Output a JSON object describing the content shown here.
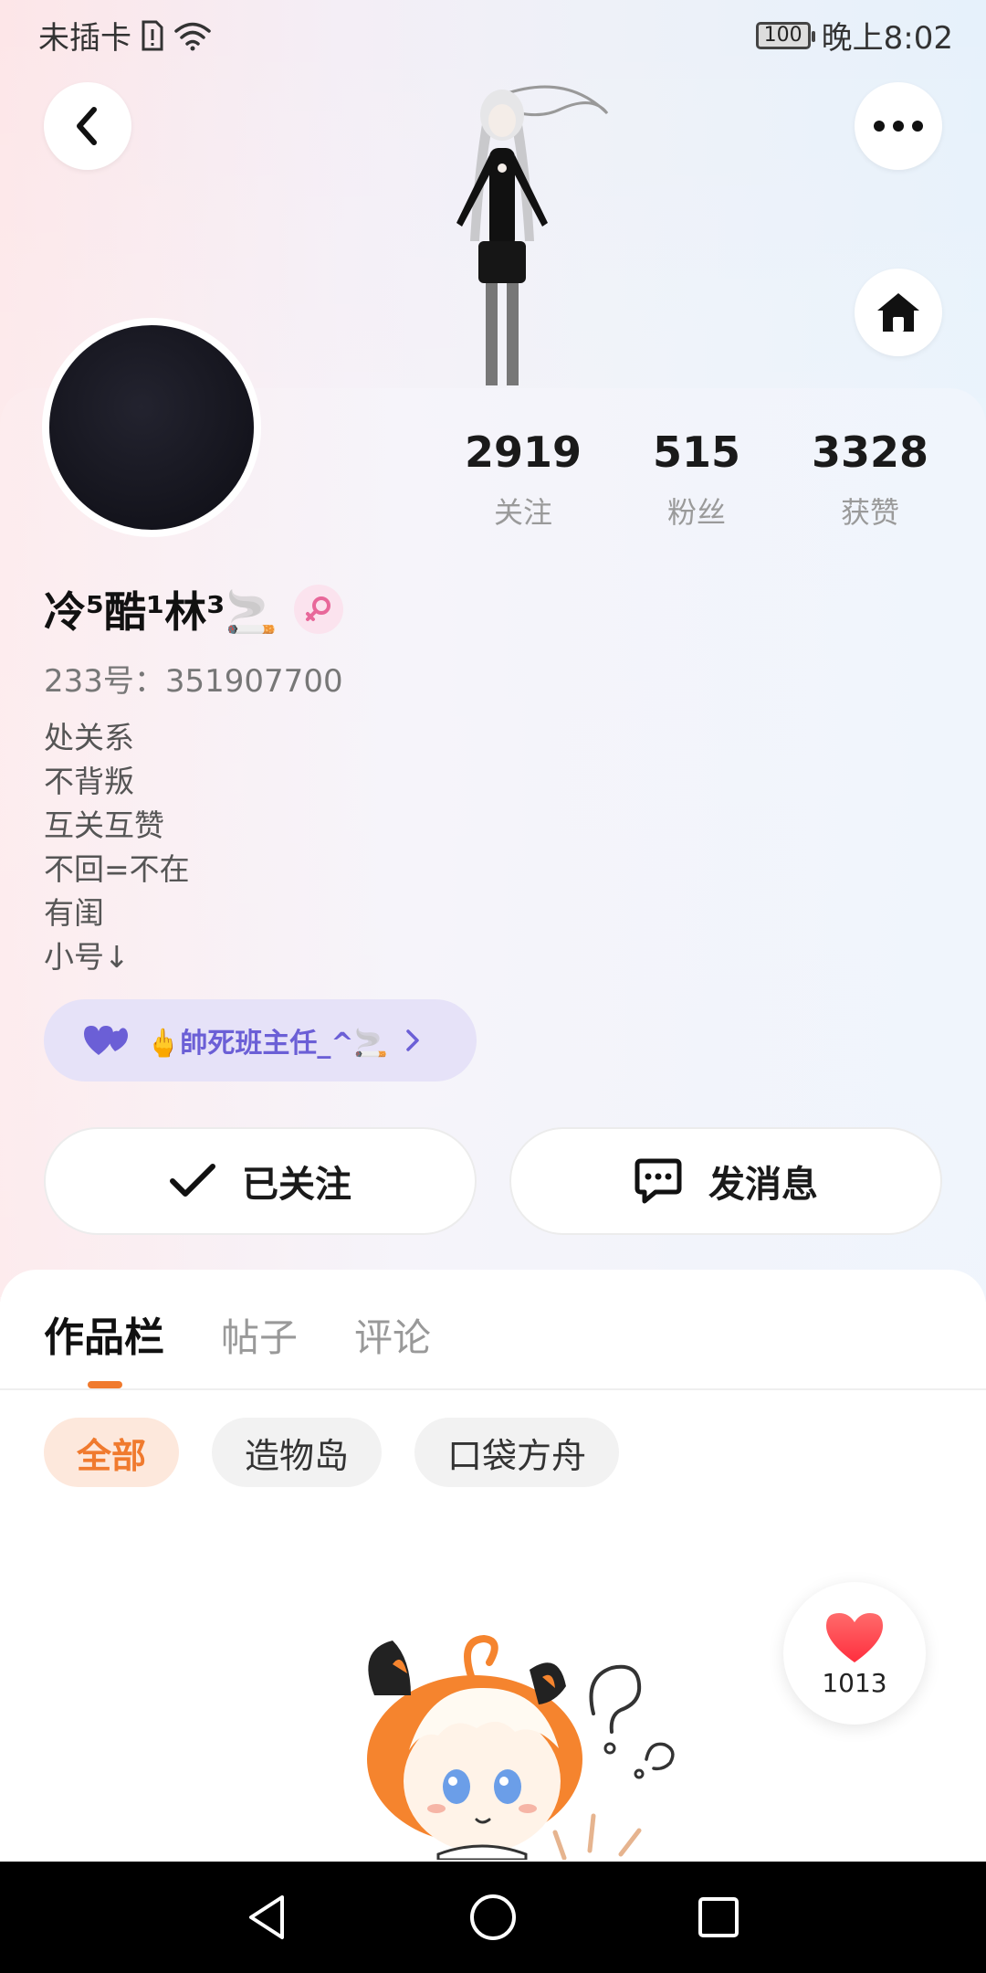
{
  "status_bar": {
    "carrier": "未插卡",
    "battery": "100",
    "time": "晚上8:02"
  },
  "header": {
    "back_icon": "chevron-left-icon",
    "more_icon": "more-dots-icon",
    "home_icon": "home-icon"
  },
  "profile": {
    "stats": [
      {
        "value": "2919",
        "label": "关注"
      },
      {
        "value": "515",
        "label": "粉丝"
      },
      {
        "value": "3328",
        "label": "获赞"
      }
    ],
    "username": "冷⁵酷¹林³🚬",
    "uid": "233号：351907700",
    "bio": [
      "处关系",
      "不背叛",
      "互关互赞",
      "不回=不在",
      "有闺",
      "小号↓"
    ],
    "linked_account": "🖕帥死班主任_^🚬",
    "follow_button": "已关注",
    "message_button": "发消息"
  },
  "tabs": [
    {
      "label": "作品栏",
      "active": true
    },
    {
      "label": "帖子",
      "active": false
    },
    {
      "label": "评论",
      "active": false
    }
  ],
  "filters": [
    {
      "label": "全部",
      "active": true
    },
    {
      "label": "造物岛",
      "active": false
    },
    {
      "label": "口袋方舟",
      "active": false
    }
  ],
  "like_fab": {
    "count": "1013"
  },
  "colors": {
    "accent": "#f07a2e",
    "guild_text": "#6b5fd6",
    "guild_bg": "#e6e2f8"
  }
}
